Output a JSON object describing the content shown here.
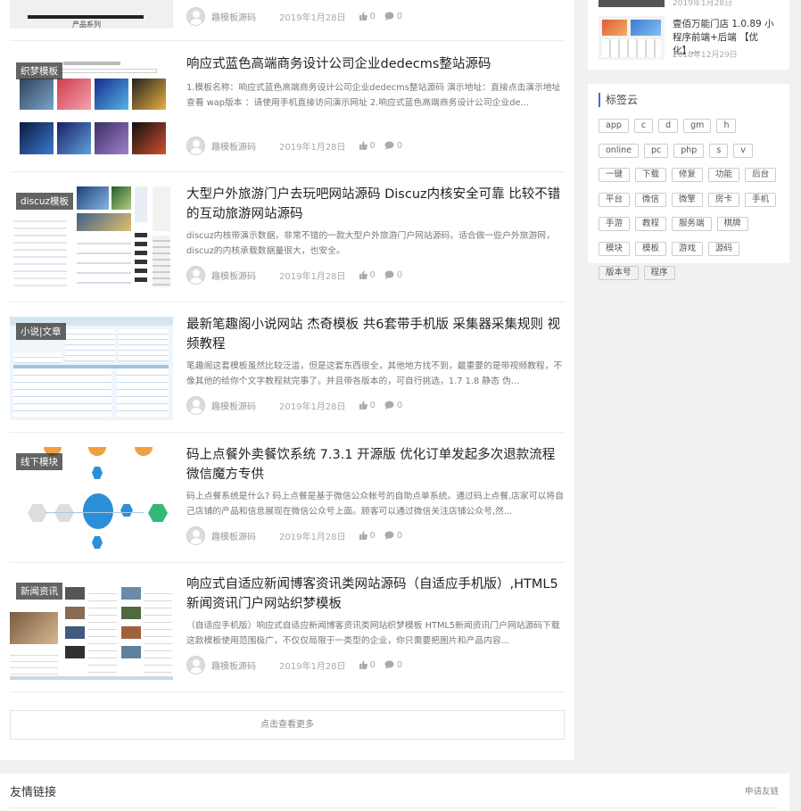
{
  "posts": [
    {
      "tag": "",
      "thumb_caption": "产品系列",
      "title": "",
      "excerpt": "",
      "author": "趣模板源码",
      "date": "2019年1月28日",
      "likes": "0",
      "comments": "0"
    },
    {
      "tag": "织梦模板",
      "title": "响应式蓝色高端商务设计公司企业dedecms整站源码",
      "excerpt": "1.模板名称：响应式蓝色高端商务设计公司企业dedecms整站源码 演示地址：直接点击演示地址查看 wap版本 ：请使用手机直接访问演示网址 2.响应式蓝色高端商务设计公司企业de...",
      "author": "趣模板源码",
      "date": "2019年1月28日",
      "likes": "0",
      "comments": "0"
    },
    {
      "tag": "discuz模板",
      "title": "大型户外旅游门户去玩吧网站源码 Discuz内核安全可靠 比较不错的互动旅游网站源码",
      "excerpt": "discuz内核带演示数据，非常不错的一款大型户外旅游门户网站源码，适合做一些户外旅游网，discuz的内核承载数据量很大，也安全。",
      "author": "趣模板源码",
      "date": "2019年1月28日",
      "likes": "0",
      "comments": "0"
    },
    {
      "tag": "小说|文章",
      "title": "最新笔趣阁小说网站 杰奇模板 共6套带手机版 采集器采集规则 视频教程",
      "excerpt": "笔趣阁这套模板虽然比较泛滥，但是这套东西很全，其他地方找不到，最重要的是带视频教程，不像其他的给你个文字教程就完事了。并且带各版本的，可自行挑选，1.7 1.8 静态 伪...",
      "author": "趣模板源码",
      "date": "2019年1月28日",
      "likes": "0",
      "comments": "0"
    },
    {
      "tag": "线下模块",
      "title": "码上点餐外卖餐饮系统 7.3.1 开源版 优化订单发起多次退款流程 微信魔方专供",
      "excerpt": "码上点餐系统是什么? 码上点餐是基于微信公众帐号的自助点单系统。通过码上点餐,店家可以将自己店铺的产品和信息展现在微信公众号上面。顾客可以通过微信关注店铺公众号,然...",
      "author": "趣模板源码",
      "date": "2019年1月28日",
      "likes": "0",
      "comments": "0"
    },
    {
      "tag": "新闻资讯",
      "title": "响应式自适应新闻博客资讯类网站源码（自适应手机版）,HTML5新闻资讯门户网站织梦模板",
      "excerpt": "（自适应手机版）响应式自适应新闻博客资讯类网站织梦模板 HTML5新闻资讯门户网站源码下载 这款模板使用范围极广，不仅仅局限于一类型的企业，你只需要把图片和产品内容...",
      "author": "趣模板源码",
      "date": "2019年1月28日",
      "likes": "0",
      "comments": "0"
    }
  ],
  "more_label": "点击查看更多",
  "sidebar": {
    "top_date": "2019年1月28日",
    "item": {
      "title": "壹佰万能门店 1.0.89 小程序前端+后端 【优化】...",
      "date": "2018年12月29日"
    }
  },
  "tags_title": "标签云",
  "tags": [
    "app",
    "c",
    "d",
    "gm",
    "h",
    "online",
    "pc",
    "php",
    "s",
    "v",
    "一键",
    "下载",
    "修复",
    "功能",
    "后台",
    "平台",
    "微信",
    "微擎",
    "房卡",
    "手机",
    "手游",
    "教程",
    "服务端",
    "棋牌",
    "模块",
    "模板",
    "游戏",
    "源码",
    "版本号",
    "程序"
  ],
  "links": {
    "title": "友情链接",
    "apply": "申请友链"
  },
  "colors": {
    "accent": "#3b6ed8",
    "tag_overlay": "#2a2a2a"
  },
  "icons": {
    "like": "thumbs-up-icon",
    "comment": "comment-icon",
    "avatar": "user-avatar-icon"
  }
}
